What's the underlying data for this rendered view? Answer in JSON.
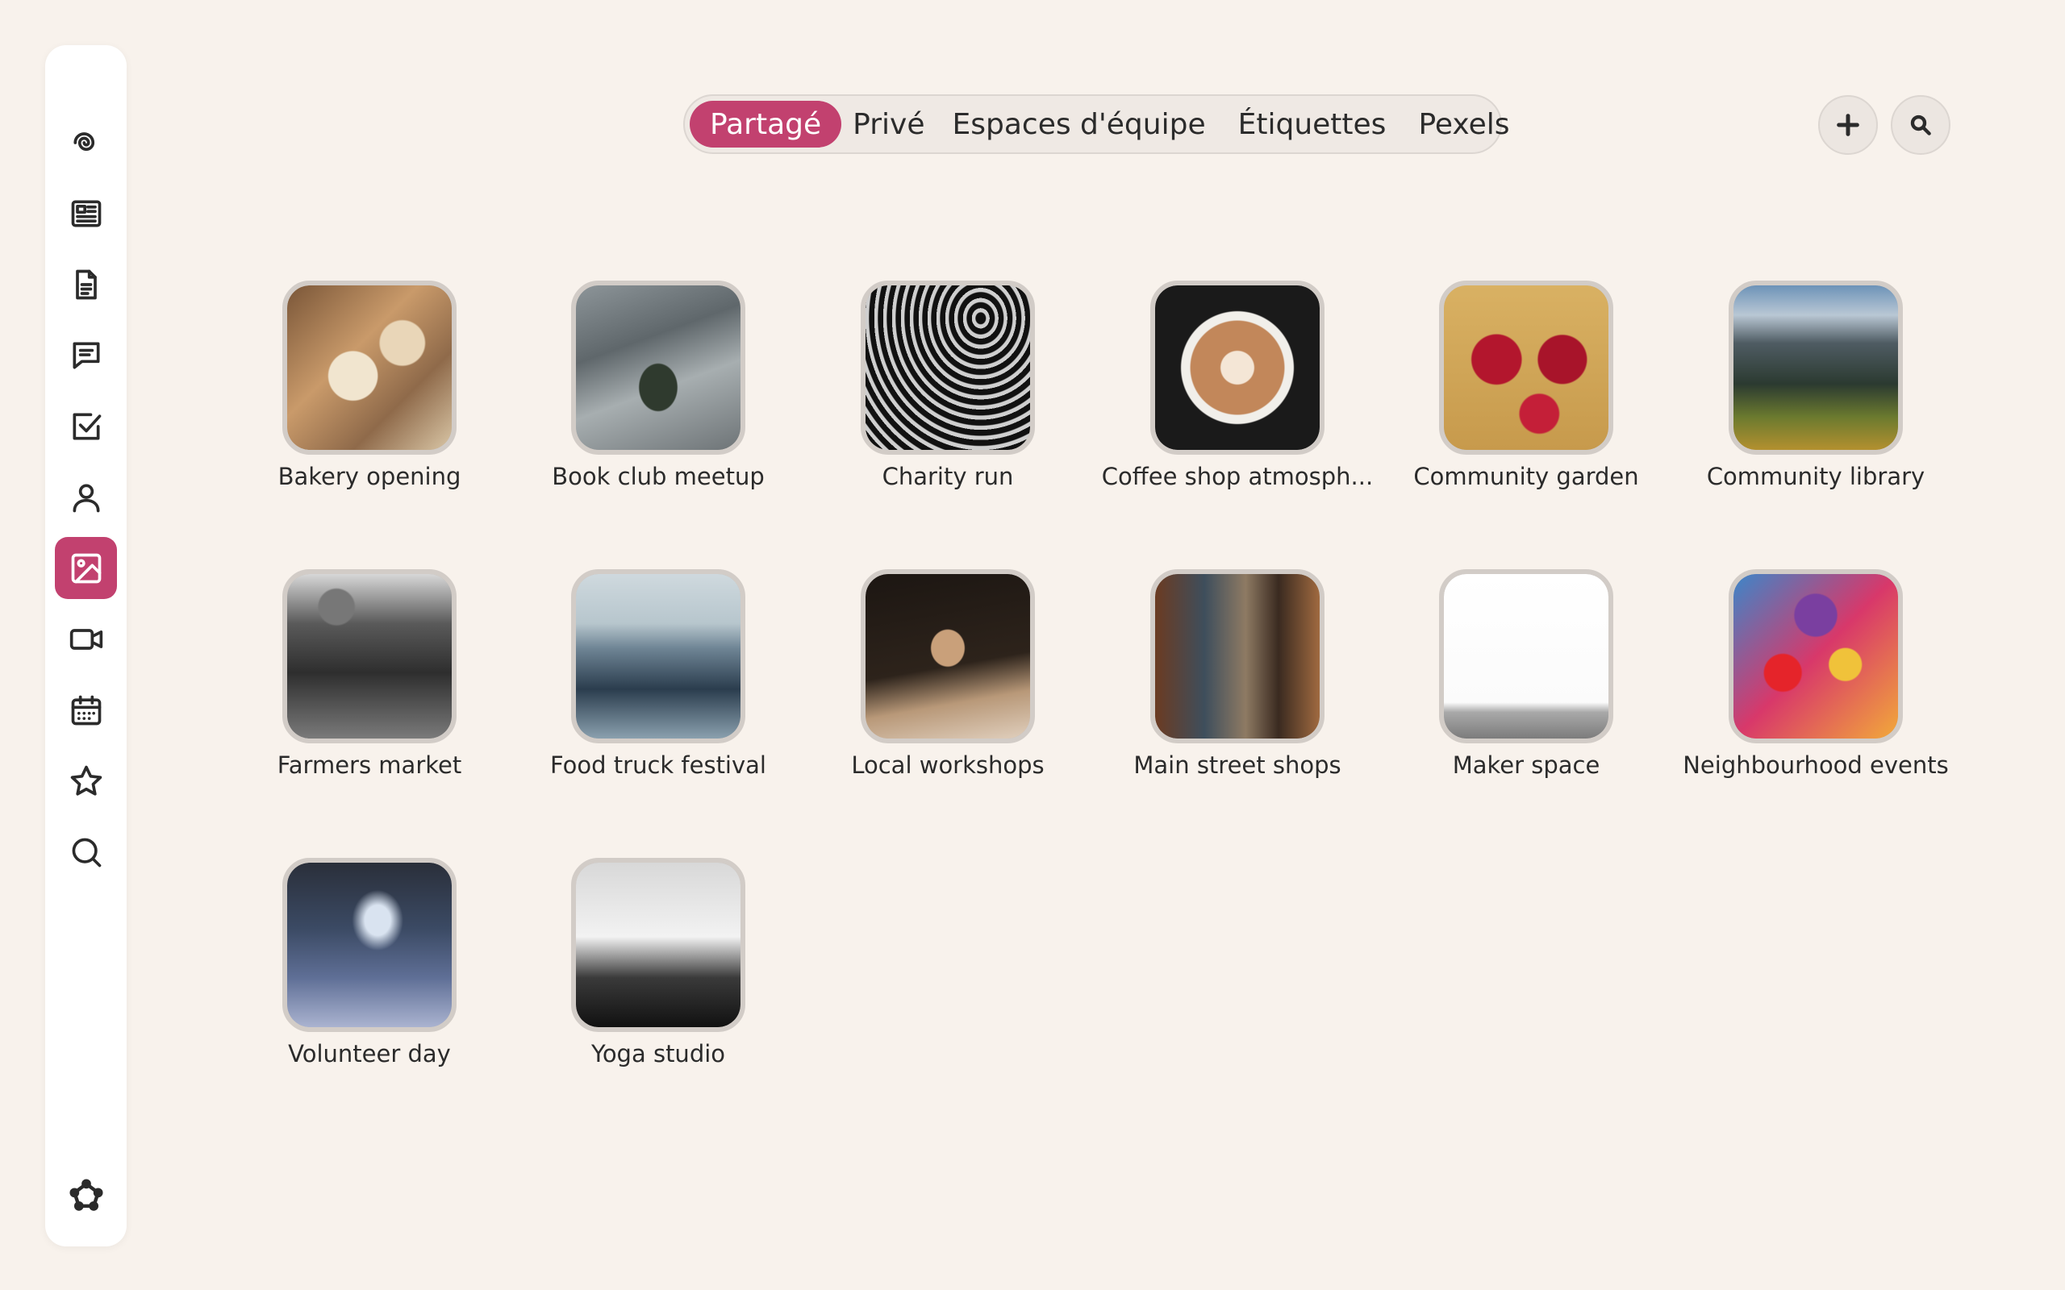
{
  "sidebar": {
    "items": [
      {
        "name": "spiral-logo-icon",
        "active": false
      },
      {
        "name": "news-icon",
        "active": false
      },
      {
        "name": "document-icon",
        "active": false
      },
      {
        "name": "chat-icon",
        "active": false
      },
      {
        "name": "tasks-icon",
        "active": false
      },
      {
        "name": "contacts-icon",
        "active": false
      },
      {
        "name": "photos-icon",
        "active": true
      },
      {
        "name": "video-icon",
        "active": false
      },
      {
        "name": "calendar-icon",
        "active": false
      },
      {
        "name": "star-icon",
        "active": false
      },
      {
        "name": "search-icon",
        "active": false
      }
    ],
    "bottom_icon": "settings-icon"
  },
  "tabs": [
    {
      "label": "Partagé",
      "active": true
    },
    {
      "label": "Privé",
      "active": false
    },
    {
      "label": "Espaces d'équipe",
      "active": false
    },
    {
      "label": "Étiquettes",
      "active": false
    },
    {
      "label": "Pexels",
      "active": false
    }
  ],
  "actions": {
    "add_icon": "plus-icon",
    "search_icon": "search-icon"
  },
  "albums": [
    {
      "label": "Bakery opening"
    },
    {
      "label": "Book club meetup"
    },
    {
      "label": "Charity run"
    },
    {
      "label": "Coffee shop atmosph..."
    },
    {
      "label": "Community garden"
    },
    {
      "label": "Community library"
    },
    {
      "label": "Farmers market"
    },
    {
      "label": "Food truck festival"
    },
    {
      "label": "Local workshops"
    },
    {
      "label": "Main street shops"
    },
    {
      "label": "Maker space"
    },
    {
      "label": "Neighbourhood events"
    },
    {
      "label": "Volunteer day"
    },
    {
      "label": "Yoga studio"
    }
  ],
  "colors": {
    "accent": "#c2416f",
    "background": "#f8f2ec"
  }
}
